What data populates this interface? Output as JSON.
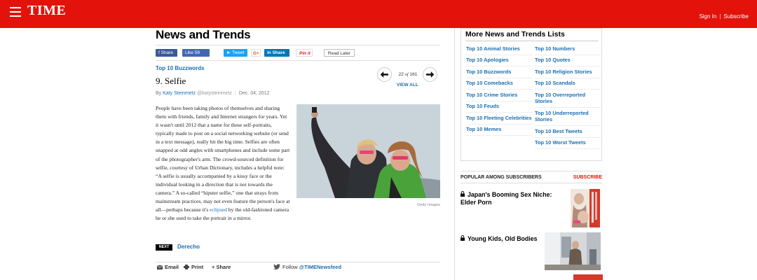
{
  "header": {
    "logo": "TIME",
    "sign_in": "Sign In",
    "separator": "|",
    "subscribe": "Subscribe"
  },
  "section": {
    "title": "News and Trends"
  },
  "share": {
    "facebook_share": "f Share",
    "facebook_like": "Like 59",
    "tweet": "Tweet",
    "google_plus": "G+",
    "linkedin_share": "in Share",
    "pinterest": "Pin it",
    "read_later": "Read Later"
  },
  "article": {
    "kicker": "Top 10 Buzzwords",
    "title": "9. Selfie",
    "by": "By",
    "author": "Katy Steinmetz",
    "twitter": "@katysteinmetz",
    "date": "Dec. 04, 2012",
    "pager": {
      "current": "22",
      "of": "of",
      "total": "161",
      "view_all": "VIEW ALL"
    },
    "body_before_link": "People have been taking photos of themselves and sharing them with friends, family and Internet strangers for years. Yet it wasn't until 2012 that a name for these self-portraits, typically made to post on a social networking website (or send in a text message), really hit the big time. Selfies are often snapped at odd angles with smartphones and include some part of the photographer's arm. The crowd-sourced definition for selfie, courtesy of Urban Dictionary, includes a helpful note: “A selfie is usually accompanied by a kissy face or the individual looking in a direction that is not towards the camera.” A so-called “hipster selfie,” one that strays from mainstream practices, may not even feature the person's face at all—perhaps because it's ",
    "body_link": "eclipsed",
    "body_after_link": " by the old-fashioned camera he or she used to take the portrait in a mirror.",
    "photo_credit": "Getty Images"
  },
  "next": {
    "badge": "NEXT",
    "title": "Derecho"
  },
  "tools": {
    "email": "Email",
    "print": "Print",
    "share": "+ Share",
    "follow": "Follow",
    "handle": "@TIMENewsfeed"
  },
  "sidebar": {
    "lists_title": "More News and Trends Lists",
    "col_a": [
      "Top 10 Animal Stories",
      "Top 10 Apologies",
      "Top 10 Buzzwords",
      "Top 10 Comebacks",
      "Top 10 Crime Stories",
      "Top 10 Feuds",
      "Top 10 Fleeting Celebrities",
      "Top 10 Memes"
    ],
    "col_b": [
      "Top 10 Numbers",
      "Top 10 Quotes",
      "Top 10 Religion Stories",
      "Top 10 Scandals",
      "Top 10 Overreported Stories",
      "Top 10 Underreported Stories",
      "Top 10 Best Tweets",
      "Top 10 Worst Tweets"
    ],
    "popular_title": "POPULAR AMONG SUBSCRIBERS",
    "popular_subscribe": "SUBSCRIBE",
    "popular": [
      "Japan's Booming Sex Niche: Elder Porn",
      "Young Kids, Old Bodies"
    ]
  },
  "colors": {
    "brand_red": "#e3120b",
    "link_blue": "#1a6fb0"
  }
}
